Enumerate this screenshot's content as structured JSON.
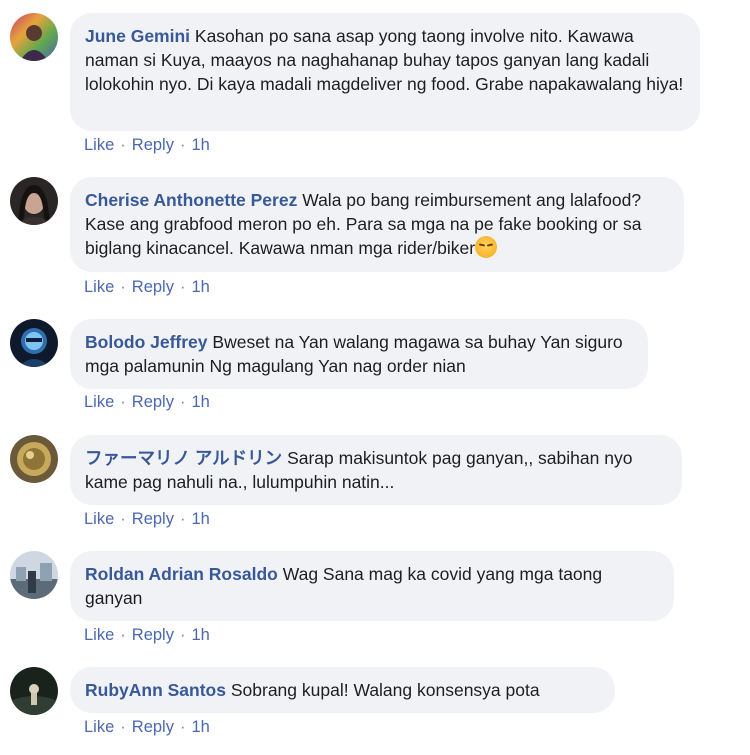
{
  "comments": [
    {
      "author": "June Gemini",
      "text": "Kasohan po sana asap yong taong involve nito. Kawawa naman si Kuya, maayos na naghahanap buhay tapos ganyan lang kadali lolokohin nyo. Di kaya madali magdeliver ng food. Grabe napakawalang hiya!",
      "like": "Like",
      "reply": "Reply",
      "time": "1h"
    },
    {
      "author": "Cherise Anthonette Perez",
      "text": "Wala po bang reimbursement ang lalafood? Kase ang grabfood meron po eh. Para sa mga na pe fake booking or sa biglang kinacancel. Kawawa nman mga rider/biker",
      "emoji": "pensive-face-emoji",
      "like": "Like",
      "reply": "Reply",
      "time": "1h"
    },
    {
      "author": "Bolodo Jeffrey",
      "text": "Bweset na Yan walang magawa sa buhay Yan siguro mga palamunin Ng magulang Yan nag order nian",
      "like": "Like",
      "reply": "Reply",
      "time": "1h"
    },
    {
      "author": "ファーマリノ アルドリン",
      "text": "Sarap makisuntok pag ganyan,, sabihan nyo kame pag nahuli na., lulumpuhin natin...",
      "like": "Like",
      "reply": "Reply",
      "time": "1h"
    },
    {
      "author": "Roldan Adrian Rosaldo",
      "text": "Wag Sana mag ka covid yang mga taong ganyan",
      "like": "Like",
      "reply": "Reply",
      "time": "1h"
    },
    {
      "author": "RubyAnn Santos",
      "text": "Sobrang kupal! Walang konsensya pota",
      "like": "Like",
      "reply": "Reply",
      "time": "1h"
    }
  ],
  "separator": "·",
  "colors": {
    "author": "#385898",
    "bubble": "#f0f2f5",
    "action": "#4b68b3",
    "text": "#1c1e21"
  }
}
